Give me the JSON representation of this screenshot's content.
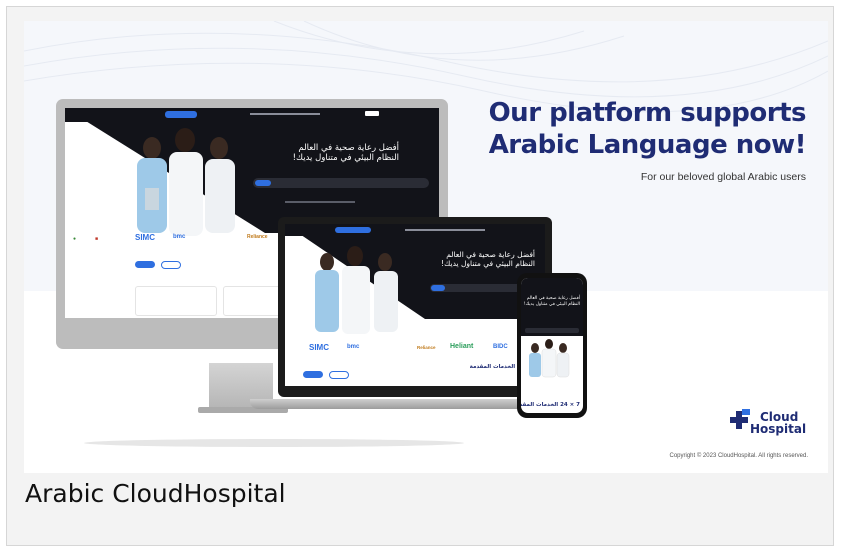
{
  "headline": {
    "line1": "Our platform supports",
    "line2": "Arabic Language now!",
    "subtitle": "For our beloved global Arabic users"
  },
  "brand": {
    "logo_line1": "Cloud",
    "logo_line2": "Hospital",
    "copyright": "Copyright © 2023 CloudHospital. All rights reserved."
  },
  "caption": "Arabic CloudHospital",
  "mockup": {
    "hero_line1": "أفضل رعاية صحية في العالم",
    "hero_line2": "النظام البيئي في متناول يديك!",
    "services_title": "7 × 24 الخدمات المقدمة",
    "logos": [
      "SIMC",
      "bmc",
      "Reliance",
      "Heliant",
      "BIDC"
    ]
  },
  "colors": {
    "navy": "#1f2c74",
    "accent_blue": "#2f6fe0",
    "dark_bg": "#121319"
  }
}
